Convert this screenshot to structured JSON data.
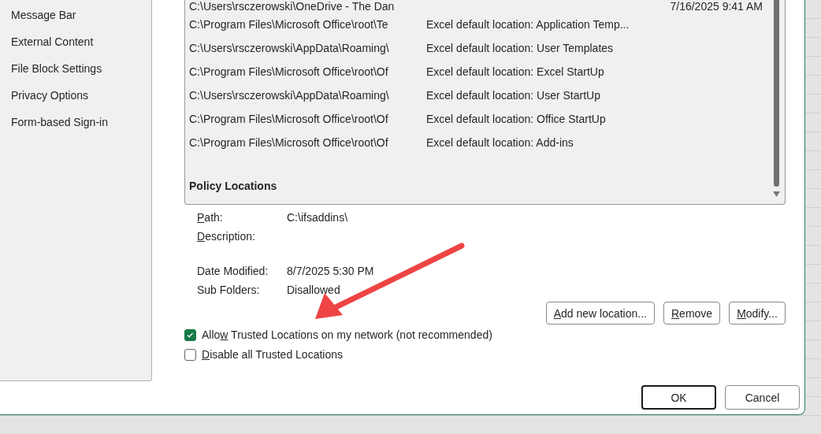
{
  "sidebar": {
    "items": [
      {
        "label": "Message Bar",
        "selected": false
      },
      {
        "label": "External Content",
        "selected": false
      },
      {
        "label": "File Block Settings",
        "selected": false
      },
      {
        "label": "Privacy Options",
        "selected": false
      },
      {
        "label": "Form-based Sign-in",
        "selected": false
      }
    ]
  },
  "locations": {
    "rows": [
      {
        "path": "C:\\Users\\rsczerowski\\OneDrive - The Dan",
        "date_modified": "7/16/2025 9:41 AM"
      },
      {
        "path": "C:\\Program Files\\Microsoft Office\\root\\Te",
        "description": "Excel default location: Application Temp..."
      },
      {
        "path": "C:\\Users\\rsczerowski\\AppData\\Roaming\\",
        "description": "Excel default location: User Templates"
      },
      {
        "path": "C:\\Program Files\\Microsoft Office\\root\\Of",
        "description": "Excel default location: Excel StartUp"
      },
      {
        "path": "C:\\Users\\rsczerowski\\AppData\\Roaming\\",
        "description": "Excel default location: User StartUp"
      },
      {
        "path": "C:\\Program Files\\Microsoft Office\\root\\Of",
        "description": "Excel default location: Office StartUp"
      },
      {
        "path": "C:\\Program Files\\Microsoft Office\\root\\Of",
        "description": "Excel default location: Add-ins"
      }
    ],
    "section_header": "Policy Locations"
  },
  "details": [
    {
      "label": [
        {
          "text": "P",
          "underline": true
        },
        {
          "text": "ath:",
          "underline": false
        }
      ],
      "value": "C:\\ifsaddins\\"
    },
    {
      "label": [
        {
          "text": "D",
          "underline": true
        },
        {
          "text": "escription:",
          "underline": false
        }
      ]
    },
    {
      "label": [
        {
          "text": "Date Modified:",
          "underline": false
        }
      ],
      "value": "8/7/2025 5:30 PM"
    },
    {
      "label": [
        {
          "text": "Sub Folders:",
          "underline": false
        }
      ],
      "value": "Disallowed"
    }
  ],
  "location_buttons": [
    {
      "label": [
        {
          "text": "A",
          "underline": true
        },
        {
          "text": "dd new location...",
          "underline": false
        }
      ]
    },
    {
      "label": [
        {
          "text": "R",
          "underline": true
        },
        {
          "text": "emove",
          "underline": false
        }
      ]
    },
    {
      "label": [
        {
          "text": "M",
          "underline": true
        },
        {
          "text": "odify...",
          "underline": false
        }
      ]
    }
  ],
  "checkboxes": [
    {
      "label": [
        {
          "text": "Allo",
          "underline": false
        },
        {
          "text": "w",
          "underline": true
        },
        {
          "text": " Trusted Locations on my network (not recommended)",
          "underline": false
        }
      ],
      "checked": true
    },
    {
      "label": [
        {
          "text": "D",
          "underline": true
        },
        {
          "text": "isable all Trusted Locations",
          "underline": false
        }
      ],
      "checked": false
    }
  ],
  "footer_buttons": [
    {
      "label": "OK",
      "default": true
    },
    {
      "label": "Cancel",
      "default": false
    }
  ]
}
